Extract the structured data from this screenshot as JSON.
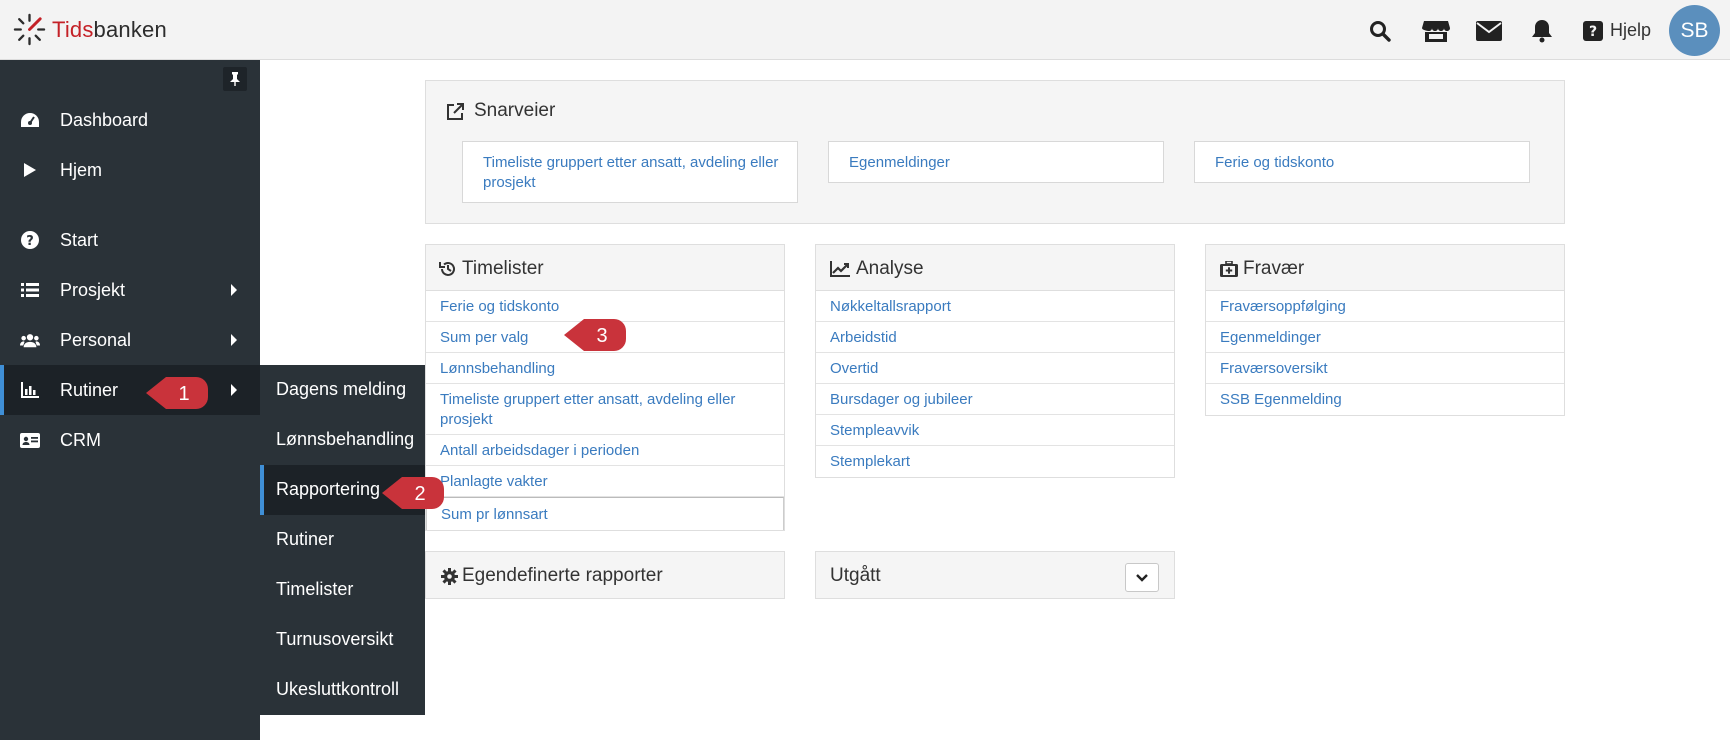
{
  "app": {
    "logo_red": "Tids",
    "logo_dark": "banken",
    "help_label": "Hjelp",
    "avatar_initials": "SB"
  },
  "sidebar": {
    "items": [
      {
        "label": "Dashboard",
        "icon": "gauge-icon"
      },
      {
        "label": "Hjem",
        "icon": "play-icon"
      },
      {
        "label": "Start",
        "icon": "question-circle-icon"
      },
      {
        "label": "Prosjekt",
        "icon": "list-icon"
      },
      {
        "label": "Personal",
        "icon": "users-icon"
      },
      {
        "label": "Rutiner",
        "icon": "bar-chart-icon"
      },
      {
        "label": "CRM",
        "icon": "id-card-icon"
      }
    ]
  },
  "submenu": {
    "items": [
      "Dagens melding",
      "Lønnsbehandling",
      "Rapportering",
      "Rutiner",
      "Timelister",
      "Turnusoversikt",
      "Ukesluttkontroll"
    ]
  },
  "callouts": [
    "1",
    "2",
    "3"
  ],
  "shortcuts": {
    "title": "Snarveier",
    "links": [
      "Timeliste gruppert etter ansatt, avdeling eller prosjekt",
      "Egenmeldinger",
      "Ferie og tidskonto"
    ]
  },
  "timelister": {
    "title": "Timelister",
    "items": [
      "Ferie og tidskonto",
      "Sum per valg",
      "Lønnsbehandling",
      "Timeliste gruppert etter ansatt, avdeling eller prosjekt",
      "Antall arbeidsdager i perioden",
      "Planlagte vakter",
      "Sum pr lønnsart"
    ]
  },
  "analyse": {
    "title": "Analyse",
    "items": [
      "Nøkkeltallsrapport",
      "Arbeidstid",
      "Overtid",
      "Bursdager og jubileer",
      "Stempleavvik",
      "Stemplekart"
    ]
  },
  "fravaer": {
    "title": "Fravær",
    "items": [
      "Fraværsoppfølging",
      "Egenmeldinger",
      "Fraværsoversikt",
      "SSB Egenmelding"
    ]
  },
  "egendefinerte": {
    "title": "Egendefinerte rapporter"
  },
  "utgatt": {
    "title": "Utgått"
  },
  "colors": {
    "accent": "#3f8fd6",
    "sidebar": "#2a3238",
    "link": "#3a7bbf",
    "callout": "#c9333b",
    "brand_red": "#c42127"
  }
}
